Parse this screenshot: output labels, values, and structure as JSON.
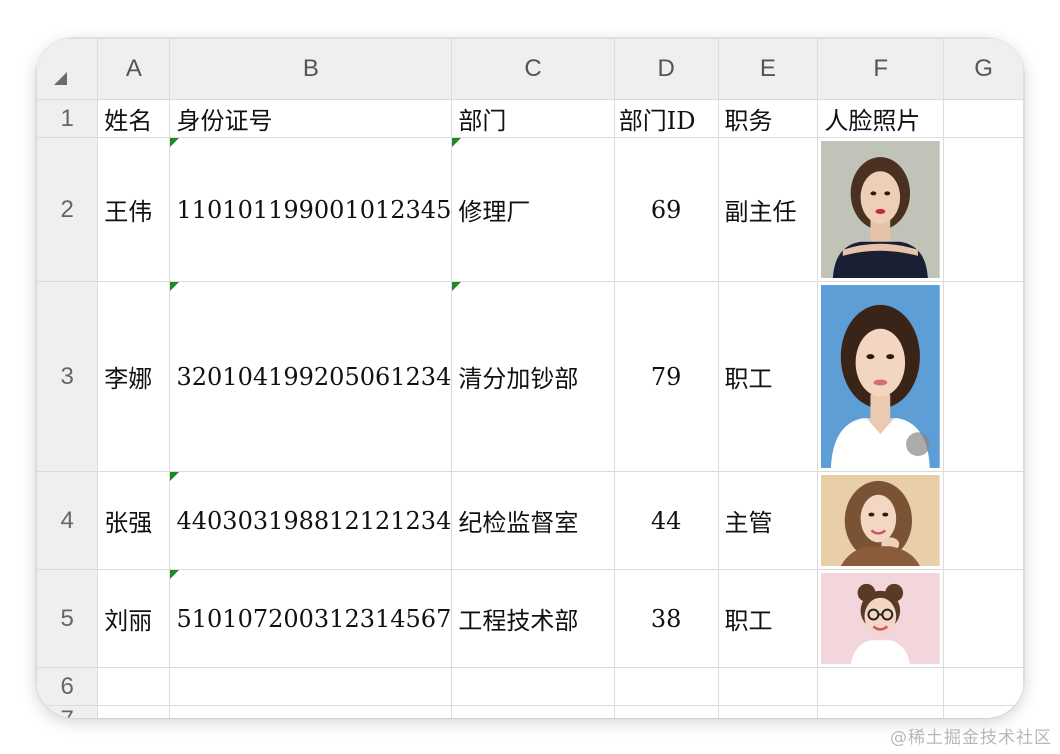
{
  "columns": [
    "A",
    "B",
    "C",
    "D",
    "E",
    "F",
    "G"
  ],
  "rows": [
    "1",
    "2",
    "3",
    "4",
    "5",
    "6",
    "7"
  ],
  "headers": {
    "name": "姓名",
    "id_number": "身份证号",
    "department": "部门",
    "department_id": "部门ID",
    "position": "职务",
    "face_photo": "人脸照片"
  },
  "records": [
    {
      "name": "王伟",
      "id_number": "110101199001012345",
      "department": "修理厂",
      "department_id": "69",
      "position": "副主任",
      "photo": "portrait-woman-dark-top"
    },
    {
      "name": "李娜",
      "id_number": "320104199205061234",
      "department": "清分加钞部",
      "department_id": "79",
      "position": "职工",
      "photo": "portrait-woman-blue-background"
    },
    {
      "name": "张强",
      "id_number": "440303198812121234",
      "department": "纪检监督室",
      "department_id": "44",
      "position": "主管",
      "photo": "portrait-woman-curly-hair"
    },
    {
      "name": "刘丽",
      "id_number": "510107200312314567",
      "department": "工程技术部",
      "department_id": "38",
      "position": "职工",
      "photo": "portrait-girl-glasses"
    }
  ],
  "watermark": "@稀土掘金技术社区",
  "colors": {
    "comment_marker": "#1e8a1e",
    "header_bg": "#efefef",
    "grid": "#dcdcdc"
  }
}
